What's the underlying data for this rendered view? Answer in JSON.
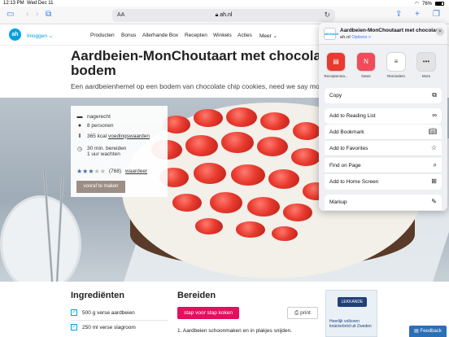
{
  "status": {
    "time": "12:13 PM",
    "date": "Wed Dec 11",
    "battery": "76%"
  },
  "toolbar": {
    "aa": "AA",
    "url": "ah.nl"
  },
  "site": {
    "logo": "ah",
    "login": "Inloggen ⌄",
    "nav": [
      "Producten",
      "Bonus",
      "Allerhande Box",
      "Recepten",
      "Winkels",
      "Acties",
      "Meer ⌄"
    ]
  },
  "recipe": {
    "title_line1": "Aardbeien-MonChoutaart met chocolade",
    "title_line2": "bodem",
    "subtitle": "Een aardbeienhemel op een bodem van chocolate chip cookies, need we say more?",
    "course": "nagerecht",
    "persons": "8 personen",
    "kcal_prefix": "365 kcal",
    "kcal_link": "voedingswaarden",
    "time_prep": "30 min. bereiden",
    "time_wait": "1 uur wachten",
    "rating_stars": 3,
    "reviews": "(768)",
    "rate_link": "waardeer",
    "prep_button": "vooraf te maken"
  },
  "ingredients": {
    "title": "Ingrediënten",
    "items": [
      "500 g verse aardbeien",
      "250 ml verse slagroom"
    ]
  },
  "steps": {
    "title": "Bereiden",
    "step_button": "stap voor stap koken",
    "print_button": "print",
    "step1": "1. Aardbeien schoonmaken en in plakjes snijden."
  },
  "ad": {
    "brand": "LEKKANDE",
    "text": "Heerlijk volkoren knäckebröd uit Zweden"
  },
  "feedback": "Feedback",
  "share": {
    "title": "Aardbeien-MonChoutaart met chocoladebodem",
    "domain": "ah.nl",
    "options": "Options >",
    "apps": [
      {
        "label": "Receptenma...",
        "color": "#e83a2e"
      },
      {
        "label": "News",
        "color": "#f04b5a"
      },
      {
        "label": "Reminders",
        "color": "#ffffff"
      },
      {
        "label": "More",
        "color": "#e3e3e6"
      }
    ],
    "actions": [
      {
        "label": "Copy",
        "icon": "copy-icon"
      },
      {
        "label": "Add to Reading List",
        "icon": "glasses-icon"
      },
      {
        "label": "Add Bookmark",
        "icon": "book-icon"
      },
      {
        "label": "Add to Favorites",
        "icon": "star-icon"
      },
      {
        "label": "Find on Page",
        "icon": "search-icon"
      },
      {
        "label": "Add to Home Screen",
        "icon": "plus-square-icon"
      },
      {
        "label": "Markup",
        "icon": "markup-icon"
      }
    ]
  }
}
